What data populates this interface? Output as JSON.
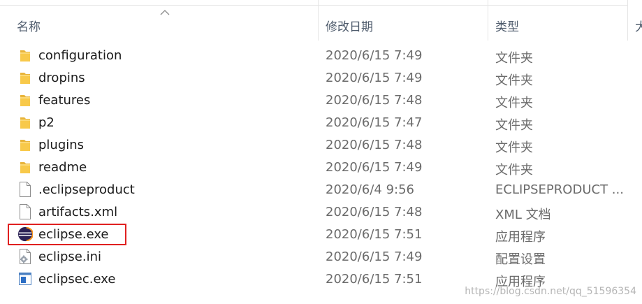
{
  "columns": {
    "name": "名称",
    "modified": "修改日期",
    "type": "类型",
    "size": "大"
  },
  "files": [
    {
      "name": "configuration",
      "date": "2020/6/15 7:49",
      "type": "文件夹",
      "icon": "folder-icon"
    },
    {
      "name": "dropins",
      "date": "2020/6/15 7:49",
      "type": "文件夹",
      "icon": "folder-icon"
    },
    {
      "name": "features",
      "date": "2020/6/15 7:48",
      "type": "文件夹",
      "icon": "folder-icon"
    },
    {
      "name": "p2",
      "date": "2020/6/15 7:47",
      "type": "文件夹",
      "icon": "folder-icon"
    },
    {
      "name": "plugins",
      "date": "2020/6/15 7:48",
      "type": "文件夹",
      "icon": "folder-icon"
    },
    {
      "name": "readme",
      "date": "2020/6/15 7:49",
      "type": "文件夹",
      "icon": "folder-icon"
    },
    {
      "name": ".eclipseproduct",
      "date": "2020/6/4 9:56",
      "type": "ECLIPSEPRODUCT ...",
      "icon": "document-icon"
    },
    {
      "name": "artifacts.xml",
      "date": "2020/6/15 7:48",
      "type": "XML 文档",
      "icon": "document-icon"
    },
    {
      "name": "eclipse.exe",
      "date": "2020/6/15 7:51",
      "type": "应用程序",
      "icon": "eclipse-icon"
    },
    {
      "name": "eclipse.ini",
      "date": "2020/6/15 7:49",
      "type": "配置设置",
      "icon": "settings-file-icon"
    },
    {
      "name": "eclipsec.exe",
      "date": "2020/6/15 7:51",
      "type": "应用程序",
      "icon": "console-app-icon"
    }
  ],
  "watermark": "https://blog.csdn.net/qq_51596354",
  "colors": {
    "folder": "#f8c94a",
    "highlight_border": "#e02020",
    "header_text": "#4d5a6b"
  }
}
